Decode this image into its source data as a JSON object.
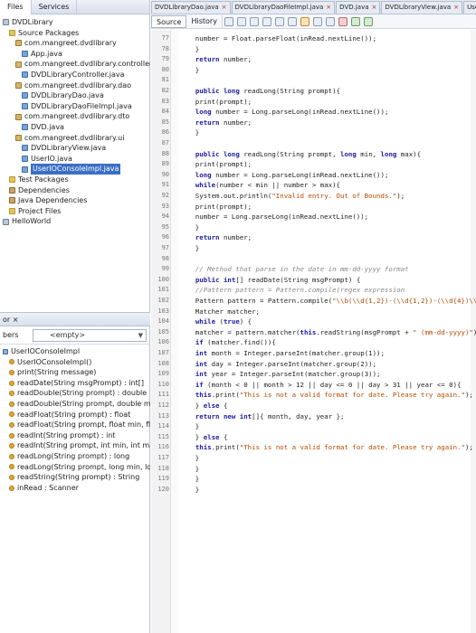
{
  "left_tabs": [
    "Files",
    "Services"
  ],
  "project_tree": [
    {
      "label": "DVDLibrary",
      "icon": "cup"
    },
    {
      "label": "Source Packages",
      "icon": "folder"
    },
    {
      "label": "com.mangreet.dvdlibrary",
      "icon": "pkg"
    },
    {
      "label": "App.java",
      "icon": "java"
    },
    {
      "label": "com.mangreet.dvdlibrary.controller",
      "icon": "pkg"
    },
    {
      "label": "DVDLibraryController.java",
      "icon": "java"
    },
    {
      "label": "com.mangreet.dvdlibrary.dao",
      "icon": "pkg"
    },
    {
      "label": "DVDLibraryDao.java",
      "icon": "java"
    },
    {
      "label": "DVDLibraryDaoFileImpl.java",
      "icon": "java"
    },
    {
      "label": "com.mangreet.dvdlibrary.dto",
      "icon": "pkg"
    },
    {
      "label": "DVD.java",
      "icon": "java"
    },
    {
      "label": "com.mangreet.dvdlibrary.ui",
      "icon": "pkg"
    },
    {
      "label": "DVDLibraryView.java",
      "icon": "java"
    },
    {
      "label": "UserIO.java",
      "icon": "java"
    },
    {
      "label": "UserIOConsoleImpl.java",
      "icon": "java",
      "selected": true
    },
    {
      "label": "Test Packages",
      "icon": "folder"
    },
    {
      "label": "Dependencies",
      "icon": "lib"
    },
    {
      "label": "Java Dependencies",
      "icon": "lib"
    },
    {
      "label": "Project Files",
      "icon": "folder"
    },
    {
      "label": "HelloWorld",
      "icon": "cup"
    }
  ],
  "navigator": {
    "header": "or ×",
    "filter_label": "bers",
    "filter_value": "<empty>",
    "items": [
      {
        "label": "UserIOConsoleImpl",
        "kind": "class"
      },
      {
        "label": "UserIOConsoleImpl()",
        "kind": "method"
      },
      {
        "label": "print(String message)",
        "kind": "method"
      },
      {
        "label": "readDate(String msgPrompt) : int[]",
        "kind": "method"
      },
      {
        "label": "readDouble(String prompt) : double",
        "kind": "method"
      },
      {
        "label": "readDouble(String prompt, double min, double max) : d",
        "kind": "method"
      },
      {
        "label": "readFloat(String prompt) : float",
        "kind": "method"
      },
      {
        "label": "readFloat(String prompt, float min, float max) : float",
        "kind": "method"
      },
      {
        "label": "readInt(String prompt) : int",
        "kind": "method"
      },
      {
        "label": "readInt(String prompt, int min, int max) : int",
        "kind": "method"
      },
      {
        "label": "readLong(String prompt) : long",
        "kind": "method"
      },
      {
        "label": "readLong(String prompt, long min, long max) : long",
        "kind": "method"
      },
      {
        "label": "readString(String prompt) : String",
        "kind": "method"
      },
      {
        "label": "inRead : Scanner",
        "kind": "field"
      }
    ]
  },
  "editor_tabs": [
    {
      "label": "DVDLibraryDao.java",
      "active": false
    },
    {
      "label": "DVDLibraryDaoFileImpl.java",
      "active": false
    },
    {
      "label": "DVD.java",
      "active": false
    },
    {
      "label": "DVDLibraryView.java",
      "active": false
    },
    {
      "label": "UserIO.java",
      "active": false
    }
  ],
  "editor_toolbar": {
    "source": "Source",
    "history": "History"
  },
  "code_lines": [
    {
      "n": "77",
      "t": "    number = Float.parseFloat(inRead.nextLine());"
    },
    {
      "n": "78",
      "t": "    }"
    },
    {
      "n": "79",
      "t": "    return number;"
    },
    {
      "n": "80",
      "t": "    }"
    },
    {
      "n": "81",
      "t": ""
    },
    {
      "n": "82",
      "t": "    public long readLong(String prompt){"
    },
    {
      "n": "83",
      "t": "    print(prompt);"
    },
    {
      "n": "84",
      "t": "    long number = Long.parseLong(inRead.nextLine());"
    },
    {
      "n": "85",
      "t": "    return number;"
    },
    {
      "n": "86",
      "t": "    }"
    },
    {
      "n": "87",
      "t": ""
    },
    {
      "n": "88",
      "t": "    public long readLong(String prompt, long min, long max){"
    },
    {
      "n": "89",
      "t": "    print(prompt);"
    },
    {
      "n": "90",
      "t": "    long number = Long.parseLong(inRead.nextLine());"
    },
    {
      "n": "91",
      "t": "    while(number < min || number > max){"
    },
    {
      "n": "92",
      "t": "    System.out.println(\"Invalid entry. Out of Bounds.\");"
    },
    {
      "n": "93",
      "t": "    print(prompt);"
    },
    {
      "n": "94",
      "t": "    number = Long.parseLong(inRead.nextLine());"
    },
    {
      "n": "95",
      "t": "    }"
    },
    {
      "n": "96",
      "t": "    return number;"
    },
    {
      "n": "97",
      "t": "    }"
    },
    {
      "n": "98",
      "t": ""
    },
    {
      "n": "99",
      "t": "    // Method that parse in the date in mm-dd-yyyy format"
    },
    {
      "n": "100",
      "t": "    public int[] readDate(String msgPrompt) {"
    },
    {
      "n": "101",
      "t": "    //Pattern pattern = Pattern.compile(regex expression"
    },
    {
      "n": "102",
      "t": "    Pattern pattern = Pattern.compile(\"\\\\b(\\\\d{1,2})-(\\\\d{1,2})-(\\\\d{4})\\\\b\");"
    },
    {
      "n": "103",
      "t": "    Matcher matcher;"
    },
    {
      "n": "104",
      "t": "    while (true) {"
    },
    {
      "n": "105",
      "t": "    matcher = pattern.matcher(this.readString(msgPrompt + \" (mm-dd-yyyy)\"));"
    },
    {
      "n": "106",
      "t": "    if (matcher.find()){"
    },
    {
      "n": "107",
      "t": "    int month = Integer.parseInt(matcher.group(1));"
    },
    {
      "n": "108",
      "t": "    int day = Integer.parseInt(matcher.group(2));"
    },
    {
      "n": "109",
      "t": "    int year = Integer.parseInt(matcher.group(3));"
    },
    {
      "n": "110",
      "t": "    if (month < 0 || month > 12 || day <= 0 || day > 31 || year <= 0){"
    },
    {
      "n": "111",
      "t": "    this.print(\"This is not a valid format for date. Please try again.\");"
    },
    {
      "n": "112",
      "t": "    } else {"
    },
    {
      "n": "113",
      "t": "    return new int[]{ month, day, year };"
    },
    {
      "n": "114",
      "t": "    }"
    },
    {
      "n": "115",
      "t": "    } else {"
    },
    {
      "n": "116",
      "t": "    this.print(\"This is not a valid format for date. Please try again.\");"
    },
    {
      "n": "117",
      "t": "    }"
    },
    {
      "n": "118",
      "t": "    }"
    },
    {
      "n": "119",
      "t": "    }"
    },
    {
      "n": "120",
      "t": "    }"
    }
  ]
}
